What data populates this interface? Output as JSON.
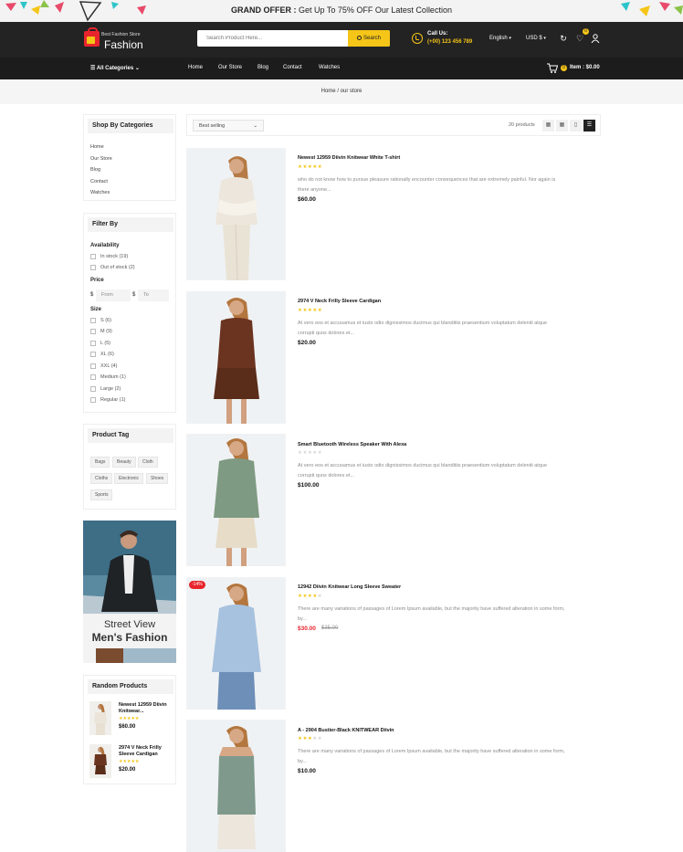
{
  "promo": {
    "strong": "GRAND OFFER :",
    "text": "Get Up To 75% OFF Our Latest Collection"
  },
  "header": {
    "logo_sub": "Best Fashion Store",
    "logo_main": "Fashion",
    "search_placeholder": "Search Product Here...",
    "search_button": "Search",
    "call_label": "Call Us:",
    "call_number": "(+00) 123 456 789",
    "language": "English",
    "currency": "USD $",
    "wishlist_count": "0"
  },
  "nav": {
    "categories_label": "All Categories",
    "links": [
      "Home",
      "Our Store",
      "Blog",
      "Contact",
      "Watches"
    ],
    "cart_count": "0",
    "cart_label": "Item : $0.00"
  },
  "breadcrumb": {
    "home": "Home",
    "sep": "/",
    "current": "our store"
  },
  "sidebar": {
    "categories_title": "Shop By Categories",
    "categories": [
      "Home",
      "Our Store",
      "Blog",
      "Contact",
      "Watches"
    ],
    "filter_title": "Filter By",
    "availability_label": "Availability",
    "availability": [
      "In stock (19)",
      "Out of stock (2)"
    ],
    "price_label": "Price",
    "currency_symbol": "$",
    "price_from": "From",
    "price_to": "To",
    "size_label": "Size",
    "sizes": [
      "S (6)",
      "M (9)",
      "L (5)",
      "XL (6)",
      "XXL (4)",
      "Medium (1)",
      "Large (2)",
      "Regular (1)"
    ],
    "tag_title": "Product Tag",
    "tags": [
      "Bags",
      "Beauty",
      "Cloth",
      "Cloths",
      "Electronic",
      "Shoes",
      "Sports"
    ],
    "banner_line1": "Street View",
    "banner_line2": "Men's Fashion",
    "random_title": "Random Products",
    "random_products": [
      {
        "title": "Newest 12959 Diivin Knitwear...",
        "stars": "★★★★★",
        "price": "$60.00"
      },
      {
        "title": "2974 V Neck Frilly Sleeve Cardigan",
        "stars": "★★★★★",
        "price": "$20.00"
      }
    ]
  },
  "toolbar": {
    "sort": "Best selling",
    "count": "20 products"
  },
  "products": [
    {
      "title": "Newest 12959 Diivin Knitwear White T-shirt",
      "rating": 5,
      "desc1": "who do not know how to pursue pleasure rationally encounter consequences that are extremely painful. Nor again is",
      "desc2": "there anyone...",
      "price": "$60.00",
      "old_price": "",
      "badge": ""
    },
    {
      "title": "2974 V Neck Frilly Sleeve Cardigan",
      "rating": 5,
      "desc1": "At vero eos et accusamus et iusto odio dignissimos ducimus qui blanditiis praesentium voluptatum deleniti atque",
      "desc2": "corrupti quos dolores et...",
      "price": "$20.00",
      "old_price": "",
      "badge": ""
    },
    {
      "title": "Smart Bluetooth Wireless Speaker With Alexa",
      "rating": 0,
      "desc1": "At vero eos et accusamus et iusto odio dignissimos ducimus qui blanditiis praesentium voluptatum deleniti atque",
      "desc2": "corrupti quos dolores et...",
      "price": "$100.00",
      "old_price": "",
      "badge": ""
    },
    {
      "title": "12942 Diivin Knitwear Long Sleeve Sweater",
      "rating": 4,
      "desc1": "There are many variations of passages of Lorem Ipsum available, but the majority have suffered alteration in some form,",
      "desc2": "by...",
      "price": "$30.00",
      "old_price": "$35.00",
      "badge": "-14%"
    },
    {
      "title": "A - 2904 Bustier-Black KNITWEAR Diivin",
      "rating": 3,
      "desc1": "There are many variations of passages of Lorem Ipsum available, but the majority have suffered alteration in some form,",
      "desc2": "by...",
      "price": "$10.00",
      "old_price": "",
      "badge": ""
    }
  ],
  "colors": {
    "accent": "#f5c518",
    "header_bg": "#232323",
    "sale": "#e8242c"
  }
}
